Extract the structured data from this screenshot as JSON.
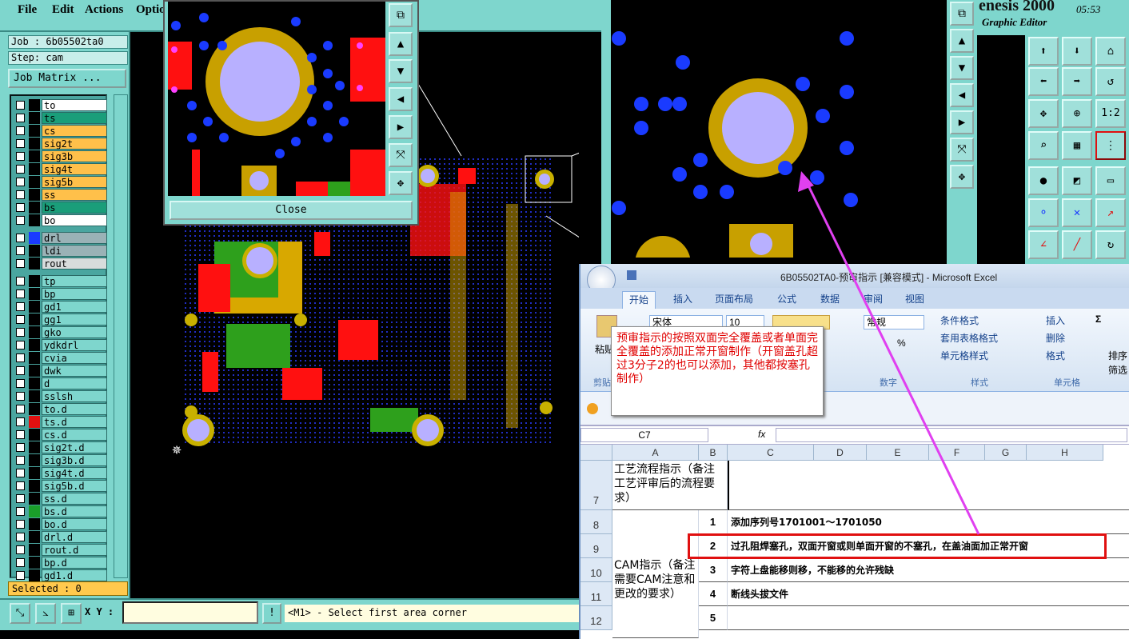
{
  "genesis": {
    "menu": [
      "File",
      "Edit",
      "Actions",
      "Optio"
    ],
    "title_partial": "enesis 2000",
    "clock": "05:53",
    "subtitle": "Graphic Editor",
    "job_label": "Job : 6b05502ta0",
    "step_label": "Step: cam",
    "job_matrix_label": "Job Matrix ...",
    "layers": [
      {
        "name": "to",
        "color": "#ffffff"
      },
      {
        "name": "ts",
        "color": "#1a9e7a"
      },
      {
        "name": "cs",
        "color": "#ffc04a"
      },
      {
        "name": "sig2t",
        "color": "#ffc04a"
      },
      {
        "name": "sig3b",
        "color": "#ffc04a"
      },
      {
        "name": "sig4t",
        "color": "#ffc04a"
      },
      {
        "name": "sig5b",
        "color": "#ffc04a"
      },
      {
        "name": "ss",
        "color": "#ffc04a"
      },
      {
        "name": "bs",
        "color": "#1a9e7a"
      },
      {
        "name": "bo",
        "color": "#ffffff"
      },
      {
        "name": "drl",
        "color": "#9ab2b6"
      },
      {
        "name": "ldi",
        "color": "#9ab2b6"
      },
      {
        "name": "rout",
        "color": "#d8dcdc"
      },
      {
        "name": "tp",
        "color": "#7ed6cd"
      },
      {
        "name": "bp",
        "color": "#7ed6cd"
      },
      {
        "name": "gd1",
        "color": "#7ed6cd"
      },
      {
        "name": "gg1",
        "color": "#7ed6cd"
      },
      {
        "name": "gko",
        "color": "#7ed6cd"
      },
      {
        "name": "ydkdrl",
        "color": "#7ed6cd"
      },
      {
        "name": "cvia",
        "color": "#7ed6cd"
      },
      {
        "name": "dwk",
        "color": "#7ed6cd"
      },
      {
        "name": "d",
        "color": "#7ed6cd"
      },
      {
        "name": "sslsh",
        "color": "#7ed6cd"
      },
      {
        "name": "to.d",
        "color": "#7ed6cd"
      },
      {
        "name": "ts.d",
        "color": "#7ed6cd"
      },
      {
        "name": "cs.d",
        "color": "#7ed6cd"
      },
      {
        "name": "sig2t.d",
        "color": "#7ed6cd"
      },
      {
        "name": "sig3b.d",
        "color": "#7ed6cd"
      },
      {
        "name": "sig4t.d",
        "color": "#7ed6cd"
      },
      {
        "name": "sig5b.d",
        "color": "#7ed6cd"
      },
      {
        "name": "ss.d",
        "color": "#7ed6cd"
      },
      {
        "name": "bs.d",
        "color": "#7ed6cd"
      },
      {
        "name": "bo.d",
        "color": "#7ed6cd"
      },
      {
        "name": "drl.d",
        "color": "#7ed6cd"
      },
      {
        "name": "rout.d",
        "color": "#7ed6cd"
      },
      {
        "name": "bp.d",
        "color": "#7ed6cd"
      },
      {
        "name": "gd1.d",
        "color": "#7ed6cd"
      }
    ],
    "selected_label": "Selected : 0",
    "xy_label": "X Y :",
    "status_message": "<M1> - Select first area corner",
    "close_label": "Close",
    "ratio_button": "1:2"
  },
  "excel": {
    "title": "6B05502TA0-预审指示 [兼容模式] - Microsoft Excel",
    "tabs": [
      "开始",
      "插入",
      "页面布局",
      "公式",
      "数据",
      "审阅",
      "视图"
    ],
    "font_name": "宋体",
    "font_size": "10",
    "number_format": "常规",
    "percent": "%",
    "group_labels": [
      "剪贴",
      "数字",
      "样式",
      "单元格"
    ],
    "style_buttons": [
      "条件格式",
      "套用表格格式",
      "单元格样式"
    ],
    "cell_buttons": [
      "插入",
      "删除",
      "格式"
    ],
    "paste_label": "粘贴",
    "sort_label": "排序",
    "filter_label": "筛选",
    "name_box": "C7",
    "fx": "fx",
    "columns": [
      "A",
      "B",
      "C",
      "D",
      "E",
      "F",
      "G",
      "H"
    ],
    "rows": [
      "7",
      "8",
      "9",
      "10",
      "11",
      "12"
    ],
    "process_label": "工艺流程指示（备注工艺评审后的流程要求）",
    "cam_label": "CAM指示（备注需要CAM注意和更改的要求）",
    "items": [
      {
        "num": "1",
        "text": "添加序列号1701001～1701050"
      },
      {
        "num": "2",
        "text": "过孔阻焊塞孔，双面开窗或则单面开窗的不塞孔，在盖油面加正常开窗"
      },
      {
        "num": "3",
        "text": "字符上盘能移则移，不能移的允许残缺"
      },
      {
        "num": "4",
        "text": "断线头拔文件"
      },
      {
        "num": "5",
        "text": ""
      }
    ],
    "note_text": "预审指示的按照双面完全覆盖或者单面完全覆盖的添加正常开窗制作（开窗盖孔超过3分子2的也可以添加，其他都按塞孔制作）"
  },
  "colors": {
    "panel": "#7ed6cd",
    "annotation_red": "#e01010",
    "arrow_magenta": "#e040f0"
  }
}
